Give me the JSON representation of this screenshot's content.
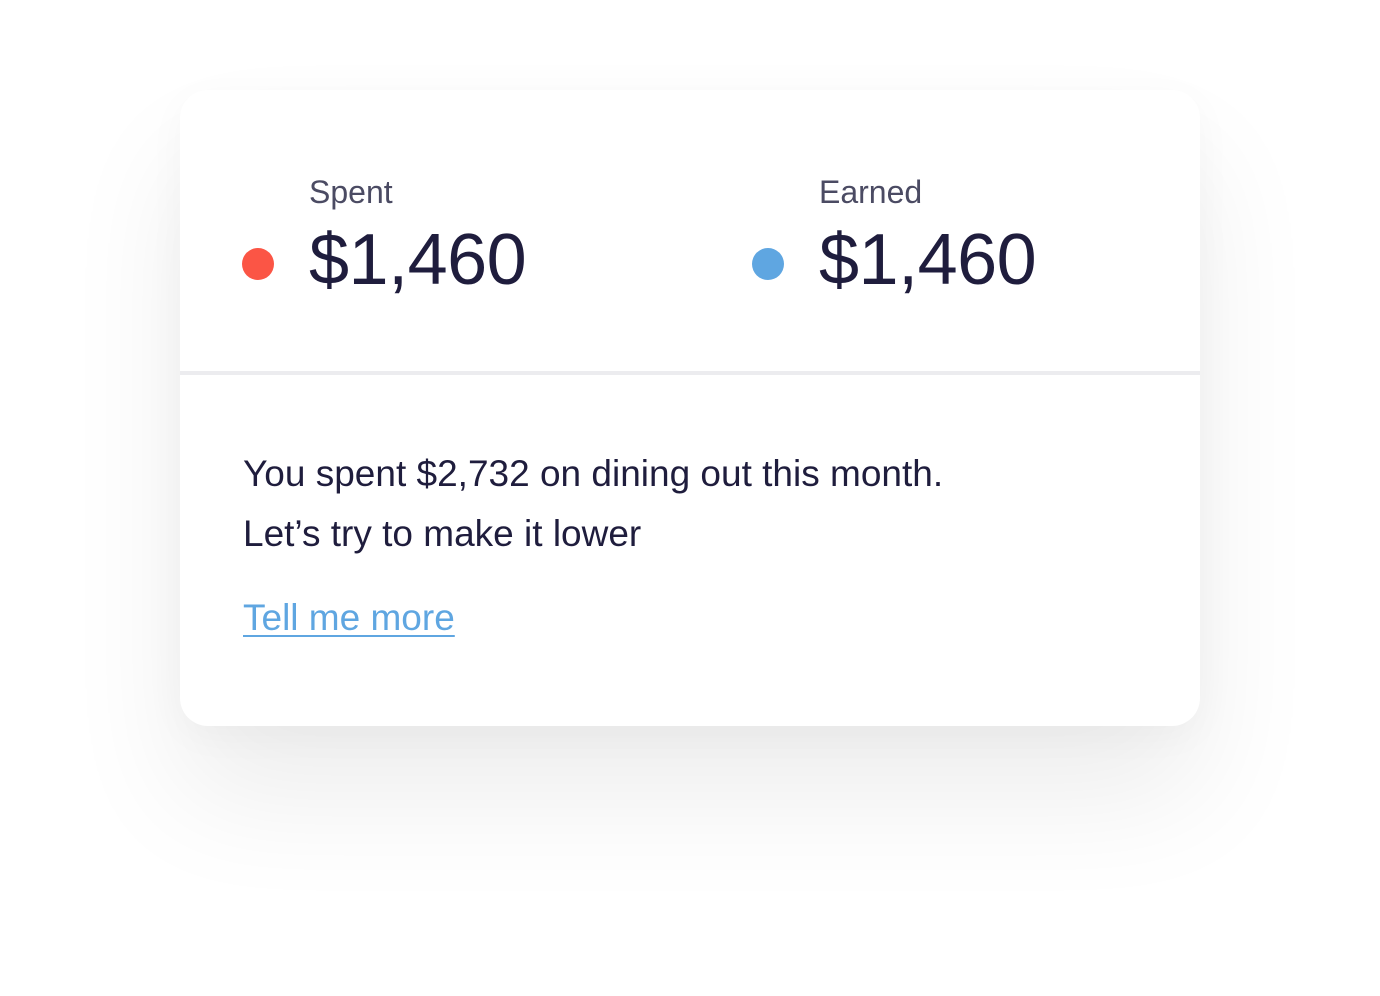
{
  "colors": {
    "spent_dot": "#fb5545",
    "earned_dot": "#5fa6e1",
    "link": "#5fa6e1",
    "text_primary": "#1f1d3d",
    "text_secondary": "#4b4b63"
  },
  "summary": {
    "spent": {
      "label": "Spent",
      "value": "$1,460",
      "dot_icon": "red-dot-icon"
    },
    "earned": {
      "label": "Earned",
      "value": "$1,460",
      "dot_icon": "blue-dot-icon"
    }
  },
  "insight": {
    "line1": "You spent $2,732 on dining out this month.",
    "line2": "Let’s try to make it lower",
    "link_label": "Tell me more"
  }
}
